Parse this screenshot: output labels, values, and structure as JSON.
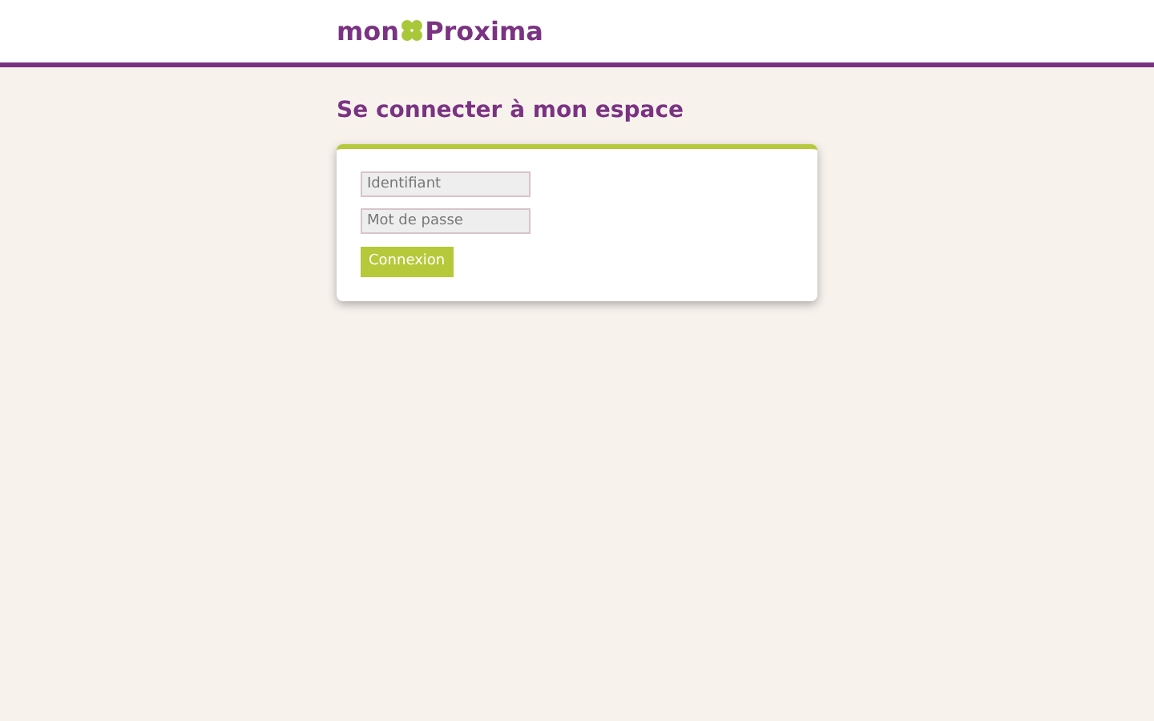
{
  "header": {
    "logo": {
      "prefix": "mon",
      "brand": "Proxima"
    }
  },
  "title": "Se connecter à mon espace",
  "form": {
    "fields": [
      {
        "placeholder": "Identifiant"
      },
      {
        "placeholder": "Mot de passe"
      }
    ],
    "submit": "Connexion"
  }
}
